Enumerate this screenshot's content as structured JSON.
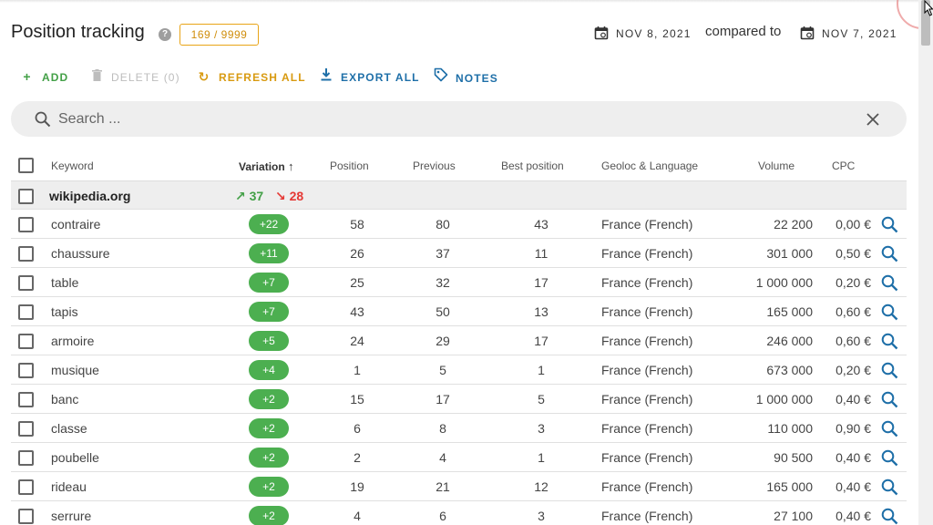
{
  "header": {
    "title": "Position tracking",
    "help": "?",
    "quota": "169 / 9999",
    "date": "NOV 8, 2021",
    "compared_label": "compared to",
    "compared_date": "NOV 7, 2021"
  },
  "toolbar": {
    "add": "ADD",
    "delete": "DELETE (0)",
    "refresh": "REFRESH ALL",
    "export": "EXPORT ALL",
    "notes": "NOTES"
  },
  "search": {
    "placeholder": "Search ..."
  },
  "table": {
    "columns": {
      "keyword": "Keyword",
      "variation": "Variation",
      "position": "Position",
      "previous": "Previous",
      "best": "Best position",
      "geoloc": "Geoloc & Language",
      "volume": "Volume",
      "cpc": "CPC"
    },
    "group": {
      "name": "wikipedia.org",
      "up": "↗ 37",
      "down": "↘ 28"
    },
    "rows": [
      {
        "keyword": "contraire",
        "variation": "+22",
        "position": "58",
        "previous": "80",
        "best": "43",
        "geoloc": "France (French)",
        "volume": "22 200",
        "cpc": "0,00 €"
      },
      {
        "keyword": "chaussure",
        "variation": "+11",
        "position": "26",
        "previous": "37",
        "best": "11",
        "geoloc": "France (French)",
        "volume": "301 000",
        "cpc": "0,50 €"
      },
      {
        "keyword": "table",
        "variation": "+7",
        "position": "25",
        "previous": "32",
        "best": "17",
        "geoloc": "France (French)",
        "volume": "1 000 000",
        "cpc": "0,20 €"
      },
      {
        "keyword": "tapis",
        "variation": "+7",
        "position": "43",
        "previous": "50",
        "best": "13",
        "geoloc": "France (French)",
        "volume": "165 000",
        "cpc": "0,60 €"
      },
      {
        "keyword": "armoire",
        "variation": "+5",
        "position": "24",
        "previous": "29",
        "best": "17",
        "geoloc": "France (French)",
        "volume": "246 000",
        "cpc": "0,60 €"
      },
      {
        "keyword": "musique",
        "variation": "+4",
        "position": "1",
        "previous": "5",
        "best": "1",
        "geoloc": "France (French)",
        "volume": "673 000",
        "cpc": "0,20 €"
      },
      {
        "keyword": "banc",
        "variation": "+2",
        "position": "15",
        "previous": "17",
        "best": "5",
        "geoloc": "France (French)",
        "volume": "1 000 000",
        "cpc": "0,40 €"
      },
      {
        "keyword": "classe",
        "variation": "+2",
        "position": "6",
        "previous": "8",
        "best": "3",
        "geoloc": "France (French)",
        "volume": "110 000",
        "cpc": "0,90 €"
      },
      {
        "keyword": "poubelle",
        "variation": "+2",
        "position": "2",
        "previous": "4",
        "best": "1",
        "geoloc": "France (French)",
        "volume": "90 500",
        "cpc": "0,40 €"
      },
      {
        "keyword": "rideau",
        "variation": "+2",
        "position": "19",
        "previous": "21",
        "best": "12",
        "geoloc": "France (French)",
        "volume": "165 000",
        "cpc": "0,40 €"
      },
      {
        "keyword": "serrure",
        "variation": "+2",
        "position": "4",
        "previous": "6",
        "best": "3",
        "geoloc": "France (French)",
        "volume": "27 100",
        "cpc": "0,40 €"
      }
    ]
  }
}
